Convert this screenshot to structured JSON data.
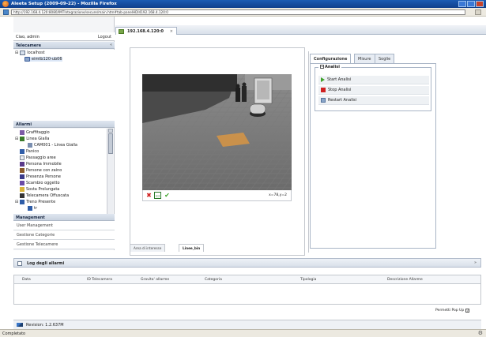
{
  "window": {
    "title": "Aleeta Setup (2009-09-22) - Mozilla Firefox"
  },
  "browser": {
    "url": "http://192.168.4.120:8080/IMTIntegrazione/secure/main.htm#tab-panelHDI4192.168.4.120:0",
    "status": "Completato"
  },
  "sidebar": {
    "user": "Ciao, admin",
    "logout": "Logout",
    "telecamere_title": "Telecamere",
    "collapse": "«",
    "tree": [
      {
        "label": "localhost"
      },
      {
        "label": "eimtb120-ub06"
      }
    ],
    "allarmi_title": "Allarmi",
    "alarms": [
      "Graffitaggio",
      "Linea Gialla",
      "CAM001 - Linea Gialla",
      "Panico",
      "Passaggio aree",
      "Persona Immobile",
      "Persone con zaino",
      "Presenza Persone",
      "Scambio oggetto",
      "Sosta Prolungata",
      "Telecamera Offuscata",
      "Treno Presente",
      "tr"
    ],
    "management_title": "Management",
    "management": [
      "User Management",
      "Gestione Categorie",
      "Gestione Telecamere"
    ]
  },
  "main": {
    "tab": {
      "label": "192.168.4.120:0",
      "close": "×"
    },
    "video": {
      "coords": "x=78,y=2"
    },
    "subtabs": [
      "Area di interesse",
      "Linee_bin"
    ],
    "config_tabs": [
      "Configurazione",
      "Misure",
      "Soglie"
    ],
    "analisi": {
      "title": "Analisi",
      "buttons": [
        "Start Analisi",
        "Stop Analisi",
        "Restart Analisi"
      ]
    }
  },
  "log": {
    "title": "Log degli allarmi",
    "expand": "»",
    "columns": [
      "Data",
      "ID Telecamera",
      "Gravita' allarme",
      "Categoria",
      "Tipologia",
      "Descrizione Allarme"
    ],
    "popup_label": "Permetti Pop Up"
  },
  "footer": {
    "revision": "Revision: 1.2.637M"
  },
  "colors": {
    "titlebar": "#1b5bb4",
    "accent_green": "#3ea32a",
    "stop_red": "#d02121"
  }
}
